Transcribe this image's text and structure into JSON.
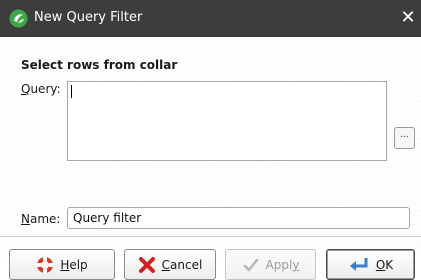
{
  "window": {
    "title": "New Query Filter",
    "close_glyph": "✕"
  },
  "form": {
    "heading": "Select rows from collar",
    "query_label_prefix": "",
    "query_label_mnemonic": "Q",
    "query_label_rest": "uery:",
    "query_value": "",
    "ellipsis_label": "...",
    "name_label_mnemonic": "N",
    "name_label_rest": "ame:",
    "name_value": "Query filter"
  },
  "buttons": {
    "help": {
      "mnemonic": "H",
      "rest": "elp",
      "icon": "lifebuoy-icon"
    },
    "cancel": {
      "mnemonic": "C",
      "rest": "ancel",
      "icon": "red-x-icon"
    },
    "apply": {
      "before": "Appl",
      "mnemonic": "y",
      "icon": "check-icon",
      "enabled": false
    },
    "ok": {
      "mnemonic": "O",
      "rest": "K",
      "icon": "enter-arrow-icon"
    }
  },
  "colors": {
    "titlebar": "#3d3d3d",
    "app_icon_green": "#3aa845",
    "help_red": "#d43a2a",
    "cancel_red": "#d42020",
    "ok_blue": "#3a7fc4"
  }
}
